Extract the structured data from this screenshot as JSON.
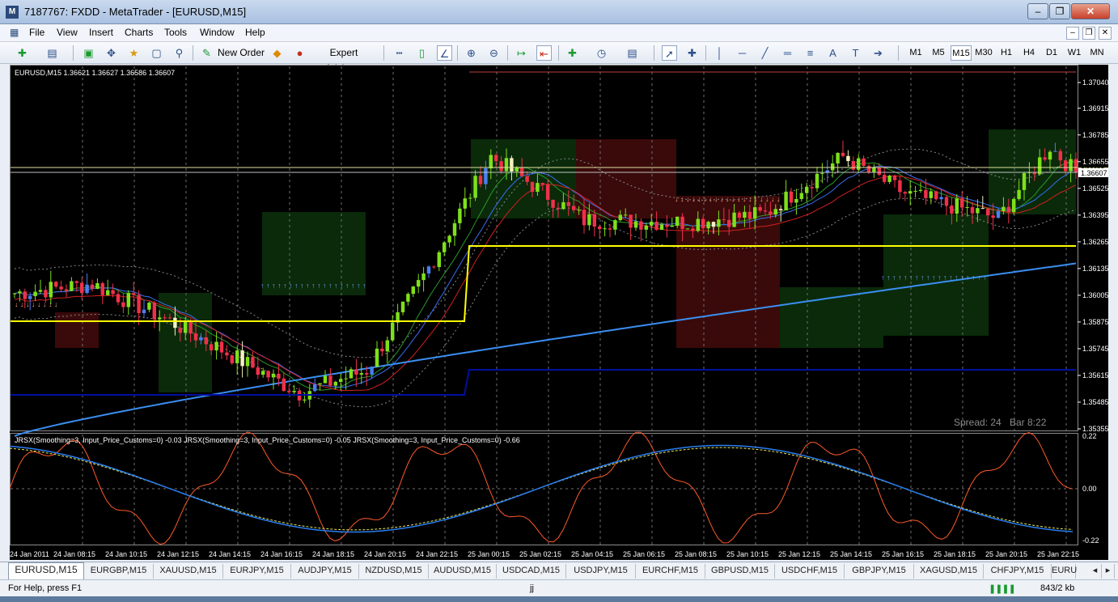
{
  "window": {
    "title": "7187767: FXDD - MetaTrader - [EURUSD,M15]",
    "app_icon": "metatrader-icon"
  },
  "menu": {
    "items": [
      "File",
      "View",
      "Insert",
      "Charts",
      "Tools",
      "Window",
      "Help"
    ]
  },
  "toolbar": {
    "new_order_label": "New Order",
    "expert_advisors_label": "Expert Advisors",
    "timeframes": [
      "M1",
      "M5",
      "M15",
      "M30",
      "H1",
      "H4",
      "D1",
      "W1",
      "MN"
    ],
    "selected_timeframe": "M15"
  },
  "chart": {
    "info": "EURUSD,M15  1.36621 1.36627 1.36586 1.36607",
    "price_labels": [
      "1.37040",
      "1.36915",
      "1.36785",
      "1.36655",
      "1.36525",
      "1.36395",
      "1.36265",
      "1.36135",
      "1.36005",
      "1.35875",
      "1.35745",
      "1.35615",
      "1.35485",
      "1.35355"
    ],
    "current_price_label": "1.36607",
    "upper_line_label": "1.36631",
    "spread_text": "Spread: 24",
    "bar_timer_text": "Bar  8:22",
    "indicator_title": "JRSX(Smoothing=3, Input_Price_Customs=0) -0.03  JRSX(Smoothing=3, Input_Price_Customs=0) -0.05  JRSX(Smoothing=3, Input_Price_Customs=0) -0.66",
    "indicator_levels": [
      "0.22",
      "0.00",
      "-0.22"
    ],
    "time_labels": [
      "24 Jan 2011",
      "24 Jan 08:15",
      "24 Jan 10:15",
      "24 Jan 12:15",
      "24 Jan 14:15",
      "24 Jan 16:15",
      "24 Jan 18:15",
      "24 Jan 20:15",
      "24 Jan 22:15",
      "25 Jan 00:15",
      "25 Jan 02:15",
      "25 Jan 04:15",
      "25 Jan 06:15",
      "25 Jan 08:15",
      "25 Jan 10:15",
      "25 Jan 12:15",
      "25 Jan 14:15",
      "25 Jan 16:15",
      "25 Jan 18:15",
      "25 Jan 20:15",
      "25 Jan 22:15"
    ],
    "colors": {
      "bull": "#7fe01a",
      "bear": "#f0304a",
      "bull_alt": "#4a7ef0",
      "bear_alt": "#f4f0c0",
      "yellow_line": "#ffff00",
      "blue_ma": "#3a8ef0",
      "dark_blue_line": "#0010a0",
      "jrsx_red": "#ff5a2a",
      "jrsx_blue": "#2a7ef0",
      "jrsx_yellow": "#e8e860"
    }
  },
  "tabs": {
    "items": [
      "EURUSD,M15",
      "EURGBP,M15",
      "XAUUSD,M15",
      "EURJPY,M15",
      "AUDJPY,M15",
      "NZDUSD,M15",
      "AUDUSD,M15",
      "USDCAD,M15",
      "USDJPY,M15",
      "EURCHF,M15",
      "GBPUSD,M15",
      "USDCHF,M15",
      "GBPJPY,M15",
      "XAGUSD,M15",
      "CHFJPY,M15",
      "EURU"
    ],
    "active": "EURUSD,M15"
  },
  "status": {
    "help": "For Help, press F1",
    "profile": "jj",
    "traffic": "843/2 kb"
  }
}
